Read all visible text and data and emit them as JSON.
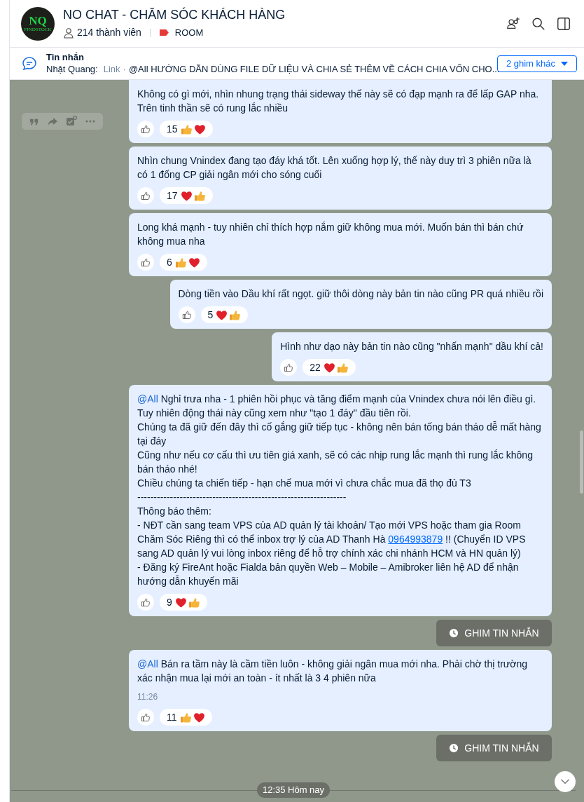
{
  "header": {
    "logo_top": "NQ",
    "logo_bottom": "FINDSTOCK",
    "title": "NO CHAT - CHĂM SÓC KHÁCH HÀNG",
    "members": "214 thành viên",
    "tag": "ROOM"
  },
  "pinned": {
    "label": "Tin nhắn",
    "sender": "Nhật Quang:",
    "link": "Link",
    "separator": "·",
    "preview": "@All HƯỚNG DẪN DÙNG FILE DỮ LIỆU VÀ CHIA SẺ THÊM VỀ CÁCH CHIA VỐN CHO...",
    "more_button": "2 ghim khác"
  },
  "messages": [
    {
      "kind": "message",
      "cut_top": true,
      "hover_toolbar": true,
      "parts": [
        {
          "kind": "text",
          "text": "Không có gì mới, nhìn nhung trạng thái sideway thế này sẽ có đạp mạnh ra để lấp GAP nha. Trên tinh thần sẽ có rung lắc nhiều"
        }
      ],
      "count": "15",
      "reactions": [
        {
          "kind": "like"
        },
        {
          "kind": "heart"
        }
      ]
    },
    {
      "kind": "message",
      "parts": [
        {
          "kind": "text",
          "text": "Nhìn chung Vnindex đang tạo đáy khá tốt. Lên xuống hợp lý, thế này duy trì 3 phiên nữa là có 1 đống CP giải ngân mới cho sóng cuối"
        }
      ],
      "count": "17",
      "reactions": [
        {
          "kind": "heart"
        },
        {
          "kind": "like"
        }
      ]
    },
    {
      "kind": "message",
      "parts": [
        {
          "kind": "text",
          "text": "Long khá mạnh - tuy nhiên chỉ thích hợp nắm giữ không mua mới. Muốn bán thì bán chứ không mua nha"
        }
      ],
      "count": "6",
      "reactions": [
        {
          "kind": "like"
        },
        {
          "kind": "heart"
        }
      ]
    },
    {
      "kind": "message",
      "parts": [
        {
          "kind": "text",
          "text": "Dòng tiền vào Dầu khí rất ngọt. giữ thôi dòng này bản tin nào cũng PR quá nhiều rồi"
        }
      ],
      "count": "5",
      "reactions": [
        {
          "kind": "heart"
        },
        {
          "kind": "like"
        }
      ]
    },
    {
      "kind": "message",
      "parts": [
        {
          "kind": "text",
          "text": "Hình như dạo này bản tin nào cũng \"nhấn mạnh\" dầu khí cả!"
        }
      ],
      "count": "22",
      "reactions": [
        {
          "kind": "heart"
        },
        {
          "kind": "like"
        }
      ]
    },
    {
      "kind": "message",
      "parts": [
        {
          "kind": "mention",
          "text": "@All"
        },
        {
          "kind": "text",
          "text": " Nghỉ trưa nha - 1 phiên hồi phục và tăng điểm mạnh của Vnindex chưa nói lên điều gì. Tuy nhiên động thái này cũng xem như \"tạo 1 đáy\" đầu tiên rồi.\nChúng ta đã giữ đến đây thì cố gắng giữ tiếp tục - không nên bán tống bán tháo dễ mất hàng tại đáy\nCũng như nếu cơ cấu thì ưu tiên giá xanh, sẽ có các nhịp rung lắc mạnh thì rung lắc không bán tháo nhé!\nChiều chúng ta chiến tiếp - hạn chế mua mới vì chưa chắc mua đã thọ đủ T3\n----------------------------------------------------------------\nThông báo thêm:\n- NĐT cần sang team VPS của AD quản lý tài khoản/ Tạo mới VPS hoặc tham gia Room Chăm Sóc Riêng thì có thể inbox trợ lý của AD Thanh Hà "
        },
        {
          "kind": "link",
          "text": "0964993879"
        },
        {
          "kind": "text",
          "text": " !! (Chuyển ID VPS sang AD quản lý vui lòng inbox riêng để hỗ trợ chính xác chi nhánh HCM và HN quản lý)\n- Đăng ký FireAnt hoặc Fialda bản quyền Web – Mobile – Amibroker liên hệ AD để nhận hướng dẫn khuyến mãi"
        }
      ],
      "count": "9",
      "reactions": [
        {
          "kind": "heart"
        },
        {
          "kind": "like"
        }
      ]
    },
    {
      "kind": "pin",
      "label": "GHIM TIN NHẮN"
    },
    {
      "kind": "message",
      "parts": [
        {
          "kind": "mention",
          "text": "@All"
        },
        {
          "kind": "text",
          "text": " Bán ra tầm này là cầm tiền luôn - không giải ngân mua mới nha. Phải chờ thị trường xác nhận mua lại mới an toàn - ít nhất là 3 4 phiên nữa"
        }
      ],
      "time": "11:26",
      "count": "11",
      "reactions": [
        {
          "kind": "like"
        },
        {
          "kind": "heart"
        }
      ]
    },
    {
      "kind": "pin",
      "label": "GHIM TIN NHẮN"
    }
  ],
  "date_divider": "12:35 Hôm nay"
}
